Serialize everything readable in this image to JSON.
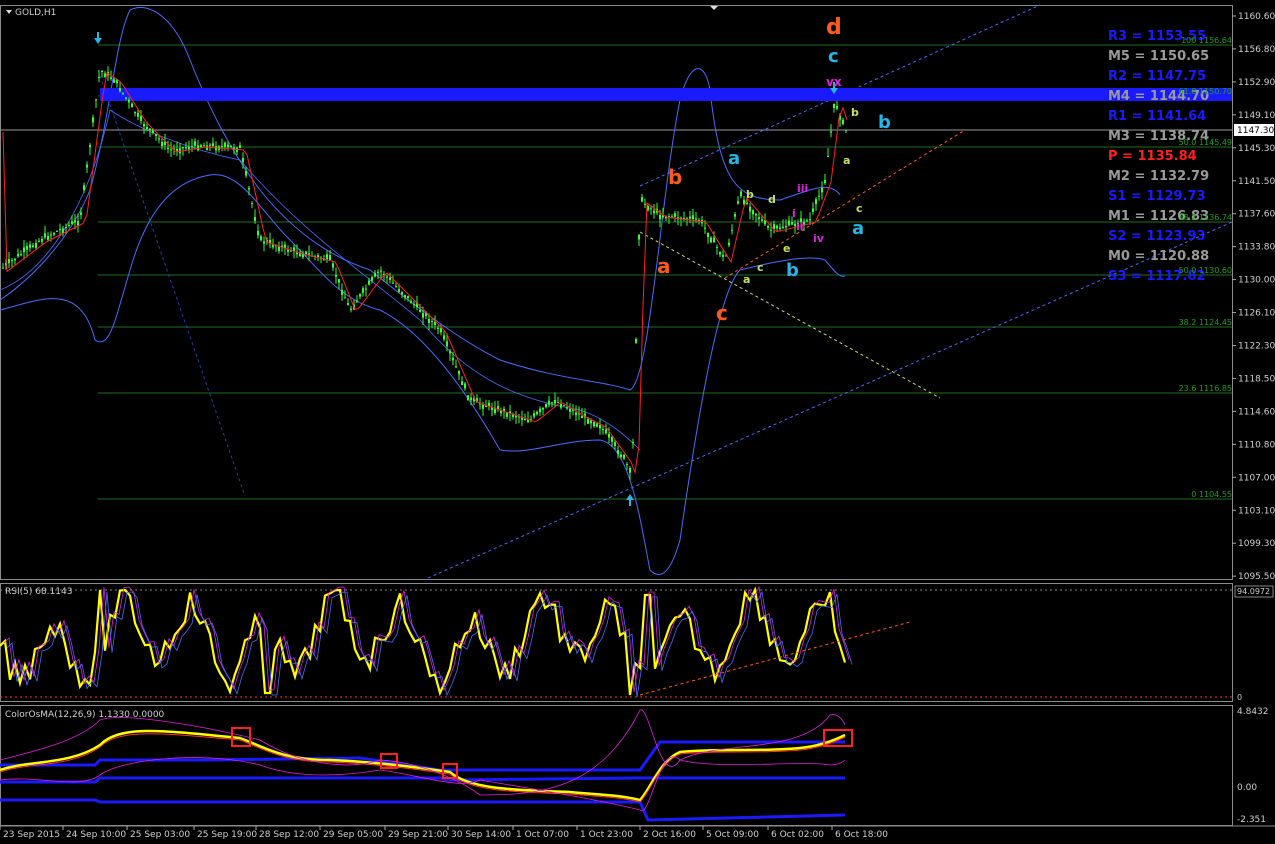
{
  "main": {
    "title": "GOLD,H1",
    "price_ticks": [
      "1160.60",
      "1156.80",
      "1152.90",
      "1149.10",
      "1145.30",
      "1141.50",
      "1137.60",
      "1133.80",
      "1130.00",
      "1126.10",
      "1122.30",
      "1118.50",
      "1114.60",
      "1110.80",
      "1107.00",
      "1103.10",
      "1099.30",
      "1095.50"
    ],
    "current_price": "1147.30",
    "fib_levels": [
      "100 1156.64",
      "61.8 1150.70",
      "50.0 1145.49",
      "38.2 1136.74",
      "50.0 1130.60",
      "38.2 1124.45",
      "23.6 1116.85",
      "0 1104.55"
    ],
    "pivots": [
      {
        "text": "R3 = 1153.55",
        "color": "#1a1aff"
      },
      {
        "text": "M5 = 1150.65",
        "color": "#9a9a9a"
      },
      {
        "text": "R2 = 1147.75",
        "color": "#1a1aff"
      },
      {
        "text": "M4 = 1144.70",
        "color": "#9a9a9a"
      },
      {
        "text": "R1 = 1141.64",
        "color": "#1a1aff"
      },
      {
        "text": "M3 = 1138.74",
        "color": "#9a9a9a"
      },
      {
        "text": "P  = 1135.84",
        "color": "#ff2020"
      },
      {
        "text": "M2 = 1132.79",
        "color": "#9a9a9a"
      },
      {
        "text": "S1 = 1129.73",
        "color": "#1a1aff"
      },
      {
        "text": "M1 = 1126.83",
        "color": "#9a9a9a"
      },
      {
        "text": "S2 = 1123.93",
        "color": "#1a1aff"
      },
      {
        "text": "M0 = 1120.88",
        "color": "#9a9a9a"
      },
      {
        "text": "S3 = 1117.82",
        "color": "#1a1aff"
      }
    ],
    "wave_labels": [
      {
        "t": "d",
        "color": "#ff5a1a"
      },
      {
        "t": "c",
        "color": "#27b4e6"
      },
      {
        "t": "vx",
        "color": "#e020e0"
      },
      {
        "t": "b",
        "color": "#27b4e6"
      },
      {
        "t": "b",
        "color": "#c8e060"
      },
      {
        "t": "a",
        "color": "#27b4e6"
      },
      {
        "t": "b",
        "color": "#ff5a1a"
      },
      {
        "t": "a",
        "color": "#ff5a1a"
      },
      {
        "t": "c",
        "color": "#ff5a1a"
      },
      {
        "t": "b",
        "color": "#c8e060"
      },
      {
        "t": "d",
        "color": "#c8e060"
      },
      {
        "t": "iii",
        "color": "#e020e0"
      },
      {
        "t": "i",
        "color": "#e020e0"
      },
      {
        "t": "ii",
        "color": "#e020e0"
      },
      {
        "t": "iv",
        "color": "#e020e0"
      },
      {
        "t": "e",
        "color": "#c8e060"
      },
      {
        "t": "c",
        "color": "#c8e060"
      },
      {
        "t": "a",
        "color": "#c8e060"
      },
      {
        "t": "b",
        "color": "#27b4e6"
      },
      {
        "t": "a",
        "color": "#c8e060"
      },
      {
        "t": "c",
        "color": "#c8e060"
      },
      {
        "t": "a",
        "color": "#27b4e6"
      }
    ]
  },
  "rsi": {
    "title": "RSI(5) 68.1143",
    "top_value": "94.0972",
    "bottom_value": "0"
  },
  "osma": {
    "title": "ColorOsMA(12,26,9) 1.1330 0.0000",
    "ticks": [
      "4.8432",
      "0.00",
      "-2.351"
    ]
  },
  "time_axis": [
    "23 Sep 2015",
    "24 Sep 10:00",
    "25 Sep 03:00",
    "25 Sep 19:00",
    "28 Sep 12:00",
    "29 Sep 05:00",
    "29 Sep 21:00",
    "30 Sep 14:00",
    "1 Oct 07:00",
    "1 Oct 23:00",
    "2 Oct 16:00",
    "5 Oct 09:00",
    "6 Oct 02:00",
    "6 Oct 18:00"
  ],
  "colors": {
    "candle": "#33ff33",
    "band": "#4a6cff",
    "pivot_bar": "#1a1aff",
    "rsi_line": "#ffff00",
    "grid": "#1f6e1f"
  }
}
